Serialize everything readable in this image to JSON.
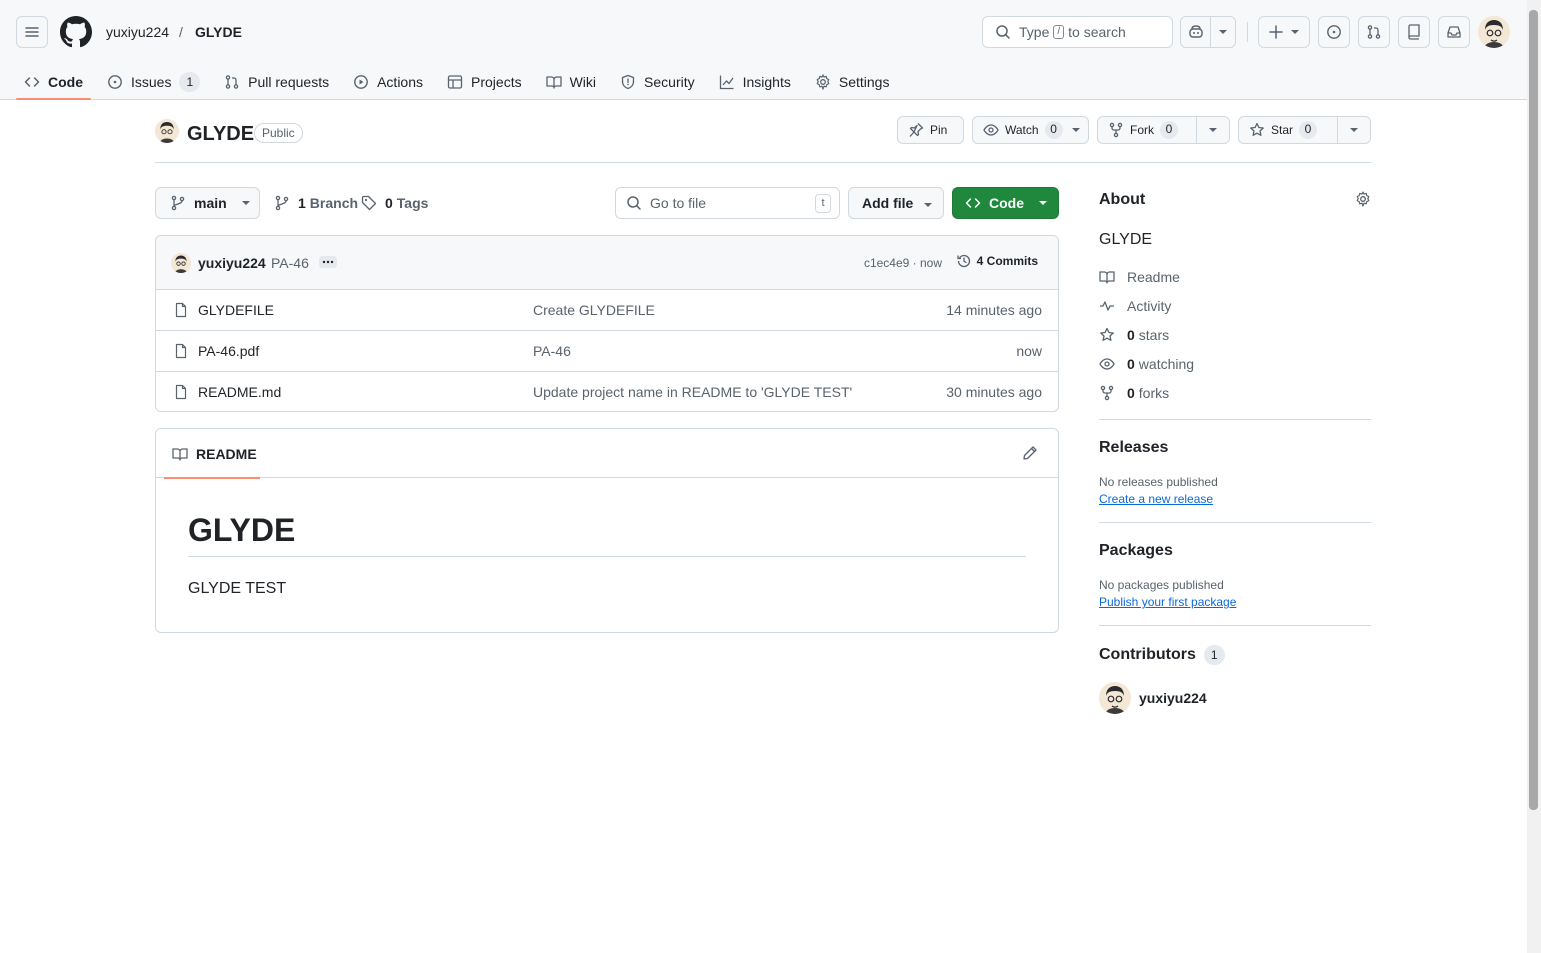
{
  "header": {
    "owner": "yuxiyu224",
    "separator": "/",
    "repo": "GLYDE",
    "search_prefix": "Type",
    "search_key": "/",
    "search_suffix": "to search"
  },
  "tabs": [
    {
      "label": "Code",
      "active": true
    },
    {
      "label": "Issues",
      "count": "1"
    },
    {
      "label": "Pull requests"
    },
    {
      "label": "Actions"
    },
    {
      "label": "Projects"
    },
    {
      "label": "Wiki"
    },
    {
      "label": "Security"
    },
    {
      "label": "Insights"
    },
    {
      "label": "Settings"
    }
  ],
  "repo": {
    "name": "GLYDE",
    "visibility": "Public",
    "pin_label": "Pin",
    "watch_label": "Watch",
    "watch_count": "0",
    "fork_label": "Fork",
    "fork_count": "0",
    "star_label": "Star",
    "star_count": "0"
  },
  "filenav": {
    "branch": "main",
    "branches_count": "1",
    "branches_label": "Branch",
    "tags_count": "0",
    "tags_label": "Tags",
    "goto_placeholder": "Go to file",
    "goto_key": "t",
    "add_file_label": "Add file",
    "code_label": "Code"
  },
  "commit": {
    "author": "yuxiyu224",
    "message": "PA-46",
    "sha_time": "c1ec4e9 · now",
    "commits_label": "4 Commits"
  },
  "files": [
    {
      "name": "GLYDEFILE",
      "message": "Create GLYDEFILE",
      "time": "14 minutes ago"
    },
    {
      "name": "PA-46.pdf",
      "message": "PA-46",
      "time": "now"
    },
    {
      "name": "README.md",
      "message": "Update project name in README to 'GLYDE TEST'",
      "time": "30 minutes ago"
    }
  ],
  "readme": {
    "tab_label": "README",
    "heading": "GLYDE",
    "body": "GLYDE TEST"
  },
  "about": {
    "title": "About",
    "description": "GLYDE",
    "readme": "Readme",
    "activity": "Activity",
    "stars_count": "0",
    "stars_label": "stars",
    "watching_count": "0",
    "watching_label": "watching",
    "forks_count": "0",
    "forks_label": "forks"
  },
  "releases": {
    "title": "Releases",
    "empty": "No releases published",
    "link": "Create a new release"
  },
  "packages": {
    "title": "Packages",
    "empty": "No packages published",
    "link": "Publish your first package"
  },
  "contributors": {
    "title": "Contributors",
    "count": "1",
    "user": "yuxiyu224"
  },
  "colors": {
    "accent_green": "#1f883d",
    "tab_underline": "#fd8c73",
    "link_blue": "#0969da"
  }
}
